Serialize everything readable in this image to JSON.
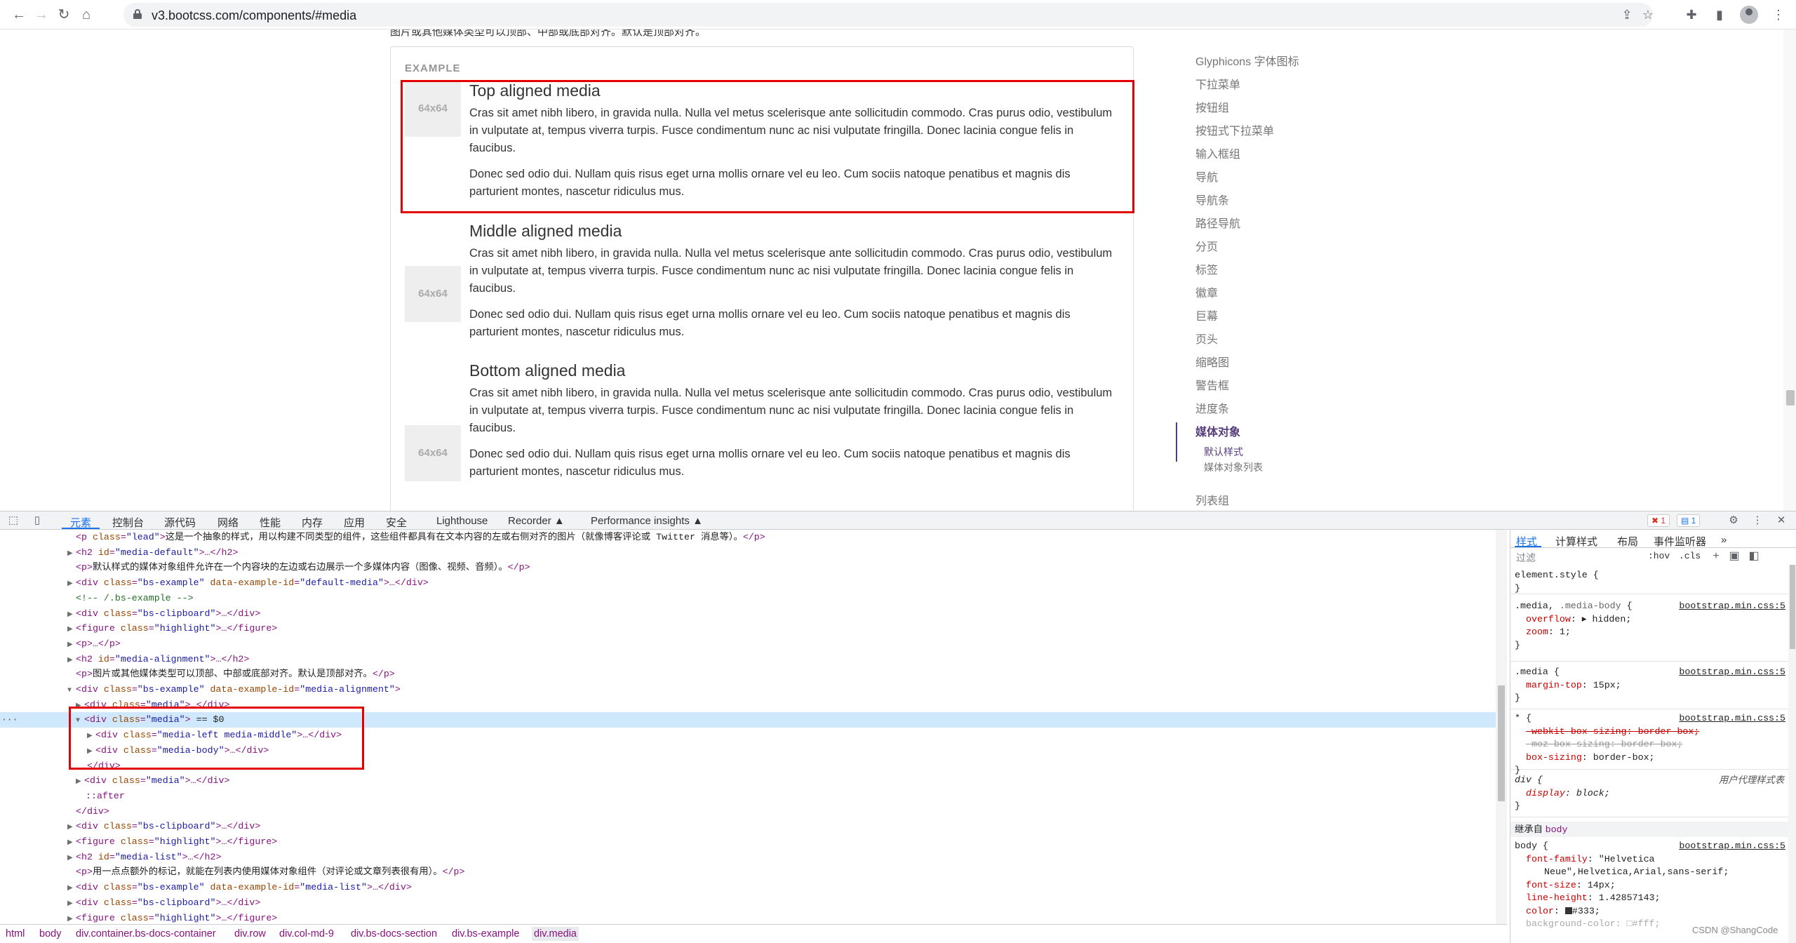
{
  "browser": {
    "url": "v3.bootcss.com/components/#media",
    "nav_icons": [
      "back-icon",
      "forward-icon",
      "reload-icon",
      "home-icon"
    ]
  },
  "page": {
    "top_clipped_text": "图片或其他媒体类型可以顶部、中部或底部对齐。默认是顶部对齐。",
    "example_label": "EXAMPLE",
    "thumb_label": "64x64",
    "media": [
      {
        "heading": "Top aligned media",
        "p1": "Cras sit amet nibh libero, in gravida nulla. Nulla vel metus scelerisque ante sollicitudin commodo. Cras purus odio, vestibulum in vulputate at, tempus viverra turpis. Fusce condimentum nunc ac nisi vulputate fringilla. Donec lacinia congue felis in faucibus.",
        "p2": "Donec sed odio dui. Nullam quis risus eget urna mollis ornare vel eu leo. Cum sociis natoque penatibus et magnis dis parturient montes, nascetur ridiculus mus."
      },
      {
        "heading": "Middle aligned media",
        "p1": "Cras sit amet nibh libero, in gravida nulla. Nulla vel metus scelerisque ante sollicitudin commodo. Cras purus odio, vestibulum in vulputate at, tempus viverra turpis. Fusce condimentum nunc ac nisi vulputate fringilla. Donec lacinia congue felis in faucibus.",
        "p2": "Donec sed odio dui. Nullam quis risus eget urna mollis ornare vel eu leo. Cum sociis natoque penatibus et magnis dis parturient montes, nascetur ridiculus mus."
      },
      {
        "heading": "Bottom aligned media",
        "p1": "Cras sit amet nibh libero, in gravida nulla. Nulla vel metus scelerisque ante sollicitudin commodo. Cras purus odio, vestibulum in vulputate at, tempus viverra turpis. Fusce condimentum nunc ac nisi vulputate fringilla. Donec lacinia congue felis in faucibus.",
        "p2": "Donec sed odio dui. Nullam quis risus eget urna mollis ornare vel eu leo. Cum sociis natoque penatibus et magnis dis parturient montes, nascetur ridiculus mus."
      }
    ],
    "sidenav": [
      "Glyphicons 字体图标",
      "下拉菜单",
      "按钮组",
      "按钮式下拉菜单",
      "输入框组",
      "导航",
      "导航条",
      "路径导航",
      "分页",
      "标签",
      "徽章",
      "巨幕",
      "页头",
      "缩略图",
      "警告框",
      "进度条",
      "媒体对象",
      "列表组"
    ],
    "sidenav_active": "媒体对象",
    "sidenav_sub": [
      "默认样式",
      "媒体对象列表"
    ],
    "highlight_color": "#e30000"
  },
  "devtools": {
    "tabs": [
      "元素",
      "控制台",
      "源代码",
      "网络",
      "性能",
      "内存",
      "应用",
      "安全",
      "Lighthouse",
      "Recorder ▲",
      "Performance insights ▲"
    ],
    "selected_tab": "元素",
    "error_count": "1",
    "message_count": "1",
    "style_tabs": [
      "样式",
      "计算样式",
      "布局",
      "事件监听器",
      "»"
    ],
    "filter_placeholder": "过滤",
    "hov": ":hov",
    "cls": ".cls",
    "inherited_label": "继承自",
    "inherited_from": "body",
    "breadcrumbs": [
      "html",
      "body",
      "div.container.bs-docs-container",
      "div.row",
      "div.col-md-9",
      "div.bs-docs-section",
      "div.bs-example",
      "div.media"
    ],
    "watermark": "CSDN @ShangCode"
  }
}
